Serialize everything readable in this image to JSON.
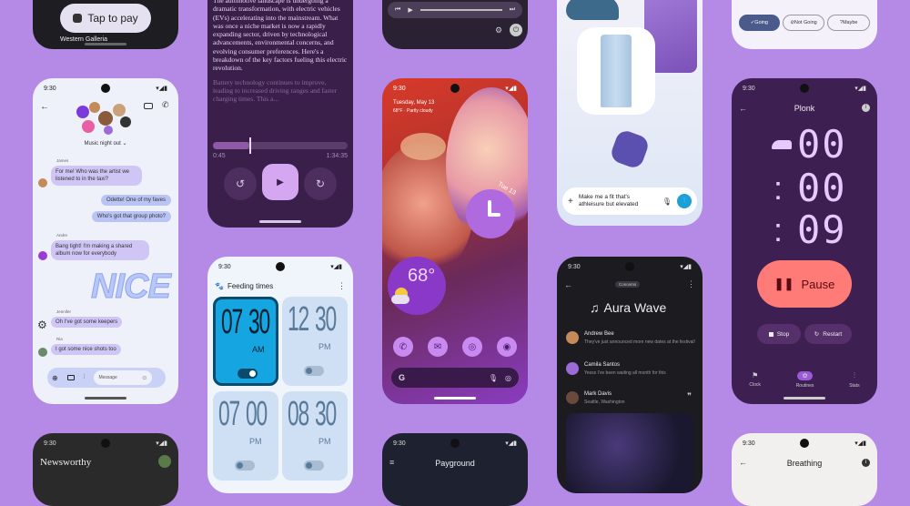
{
  "pay": {
    "tap_label": "Tap to pay",
    "merchant": "Western Galleria"
  },
  "chat": {
    "time": "9:30",
    "group": "Music night out",
    "senders": [
      "James",
      "Andre",
      "Jennifer",
      "Ria"
    ],
    "m1": "For me! Who was the artist we listened to in the taxi?",
    "m2": "Odette! One of my faves",
    "m3": "Who's got that group photo?",
    "m4": "Bang tight! I'm making a shared album now for everybody",
    "sticker": "NICE",
    "m5": "Oh I've got some keepers",
    "m6": "I got some nice shots too",
    "placeholder": "Message"
  },
  "reader": {
    "para1": "The automotive landscape is undergoing a dramatic transformation, with electric vehicles (EVs) accelerating into the mainstream. What was once a niche market is now a rapidly expanding sector, driven by technological advancements, environmental concerns, and evolving consumer preferences. Here's a breakdown of the key factors fueling this electric revolution.",
    "para2": "Battery technology continues to improve, leading to increased driving ranges and faster charging times. This a...",
    "elapsed": "0:45",
    "duration": "1:34:35",
    "progress": 0.27
  },
  "feed": {
    "time": "9:30",
    "title": "Feeding times",
    "cards": [
      {
        "h": "07",
        "m": "30",
        "ap": "AM",
        "on": true
      },
      {
        "h": "12",
        "m": "30",
        "ap": "PM",
        "on": false
      },
      {
        "h": "07",
        "m": "00",
        "ap": "PM",
        "on": false
      },
      {
        "h": "08",
        "m": "30",
        "ap": "PM",
        "on": false
      }
    ]
  },
  "home": {
    "time": "9:30",
    "date": "Tuesday, May 13",
    "weather_line": "68°F · Partly cloudy",
    "temp": "68°",
    "clock_label": "Tue 13"
  },
  "shop": {
    "prompt": "Make me a fit that's athleisure but elevated"
  },
  "aura": {
    "time": "9:30",
    "badge": "Concerns",
    "title": "Aura Wave",
    "posts": [
      {
        "name": "Andrew Bee",
        "text": "They've just announced more new dates at the festival!"
      },
      {
        "name": "Camila Santos",
        "text": "Yesss I've been waiting all month for this"
      },
      {
        "name": "Mark Davis",
        "loc": "Seattle, Washington"
      }
    ]
  },
  "rsvp": {
    "options": [
      "Going",
      "Not Going",
      "Maybe"
    ]
  },
  "timer": {
    "time": "9:30",
    "title": "Plonk",
    "hh": "00",
    "mm": "00",
    "ss": "09",
    "pause": "Pause",
    "stop": "Stop",
    "restart": "Restart",
    "nav": [
      "Clock",
      "Routines",
      "Stats"
    ]
  },
  "news": {
    "time": "9:30",
    "title": "Newsworthy"
  },
  "play": {
    "time": "9:30",
    "title": "Payground"
  },
  "breath": {
    "time": "9:30",
    "title": "Breathing"
  },
  "colors": {
    "bg": "#b48ae6",
    "accent": "#ff7b78",
    "purple": "#7a3bd8",
    "tile": "#15a5e0"
  }
}
